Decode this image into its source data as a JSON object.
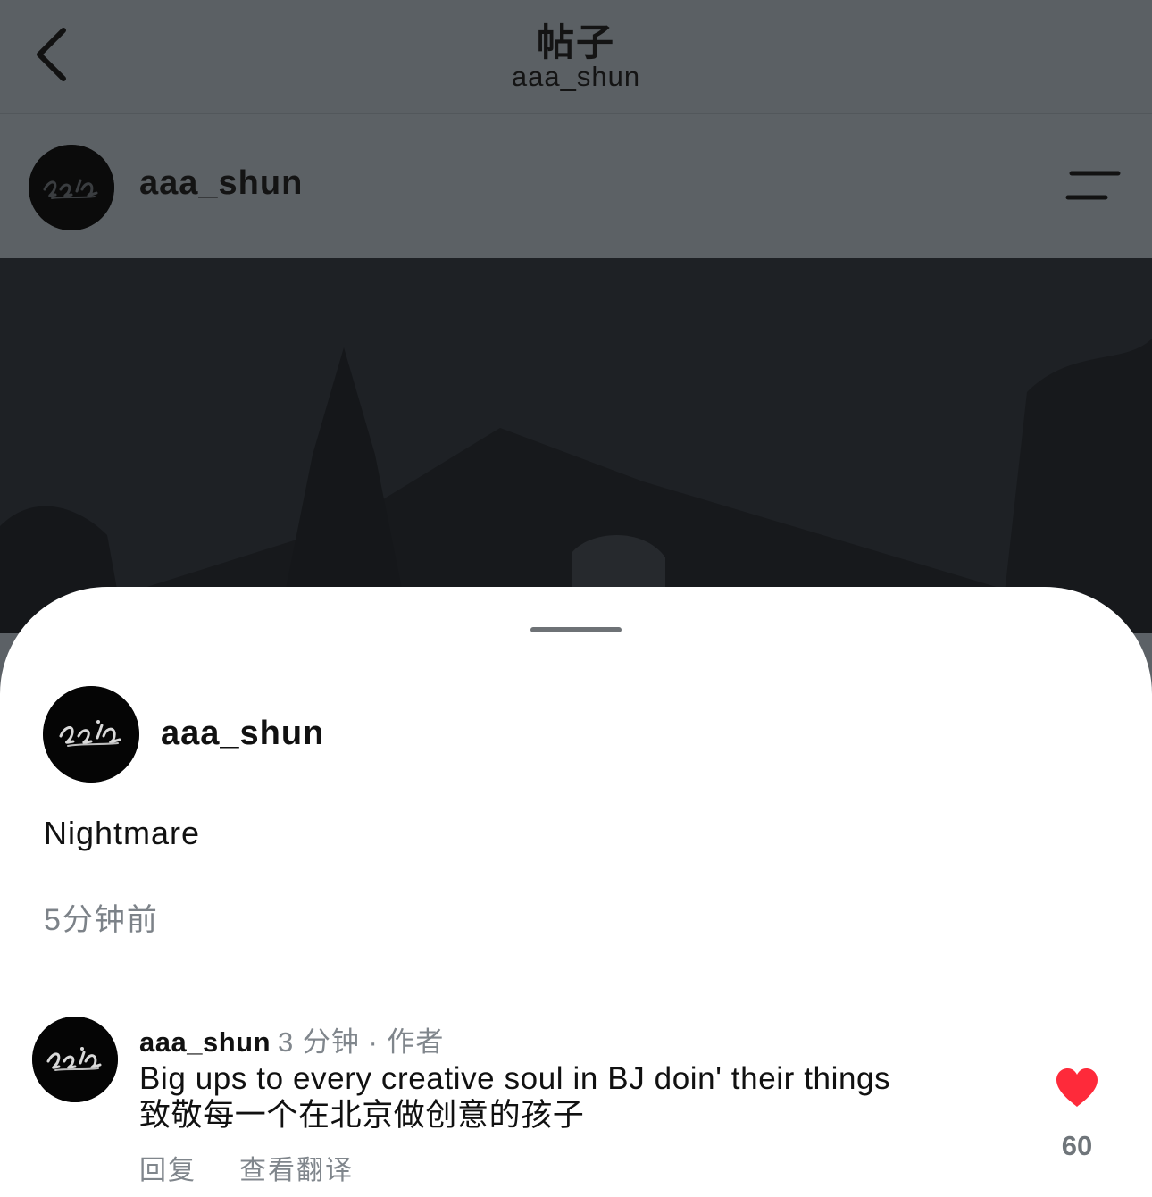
{
  "nav": {
    "title": "帖子",
    "subtitle": "aaa_shun"
  },
  "post": {
    "username": "aaa_shun"
  },
  "sheet": {
    "author_name": "aaa_shun",
    "caption": "Nightmare",
    "time": "5分钟前"
  },
  "comment": {
    "username": "aaa_shun",
    "meta": "3 分钟 · 作者",
    "text_line1": "Big ups to every creative soul in BJ doin' their things",
    "text_line2": "致敬每一个在北京做创意的孩子",
    "reply_label": "回复",
    "translate_label": "查看翻译",
    "like_count": "60"
  },
  "colors": {
    "like": "#fe2a3a",
    "dim_overlay": "#5c6165",
    "secondary_text": "#80868c"
  },
  "icons": {
    "back": "chevron-left-icon",
    "menu": "menu-icon",
    "like": "heart-icon"
  }
}
